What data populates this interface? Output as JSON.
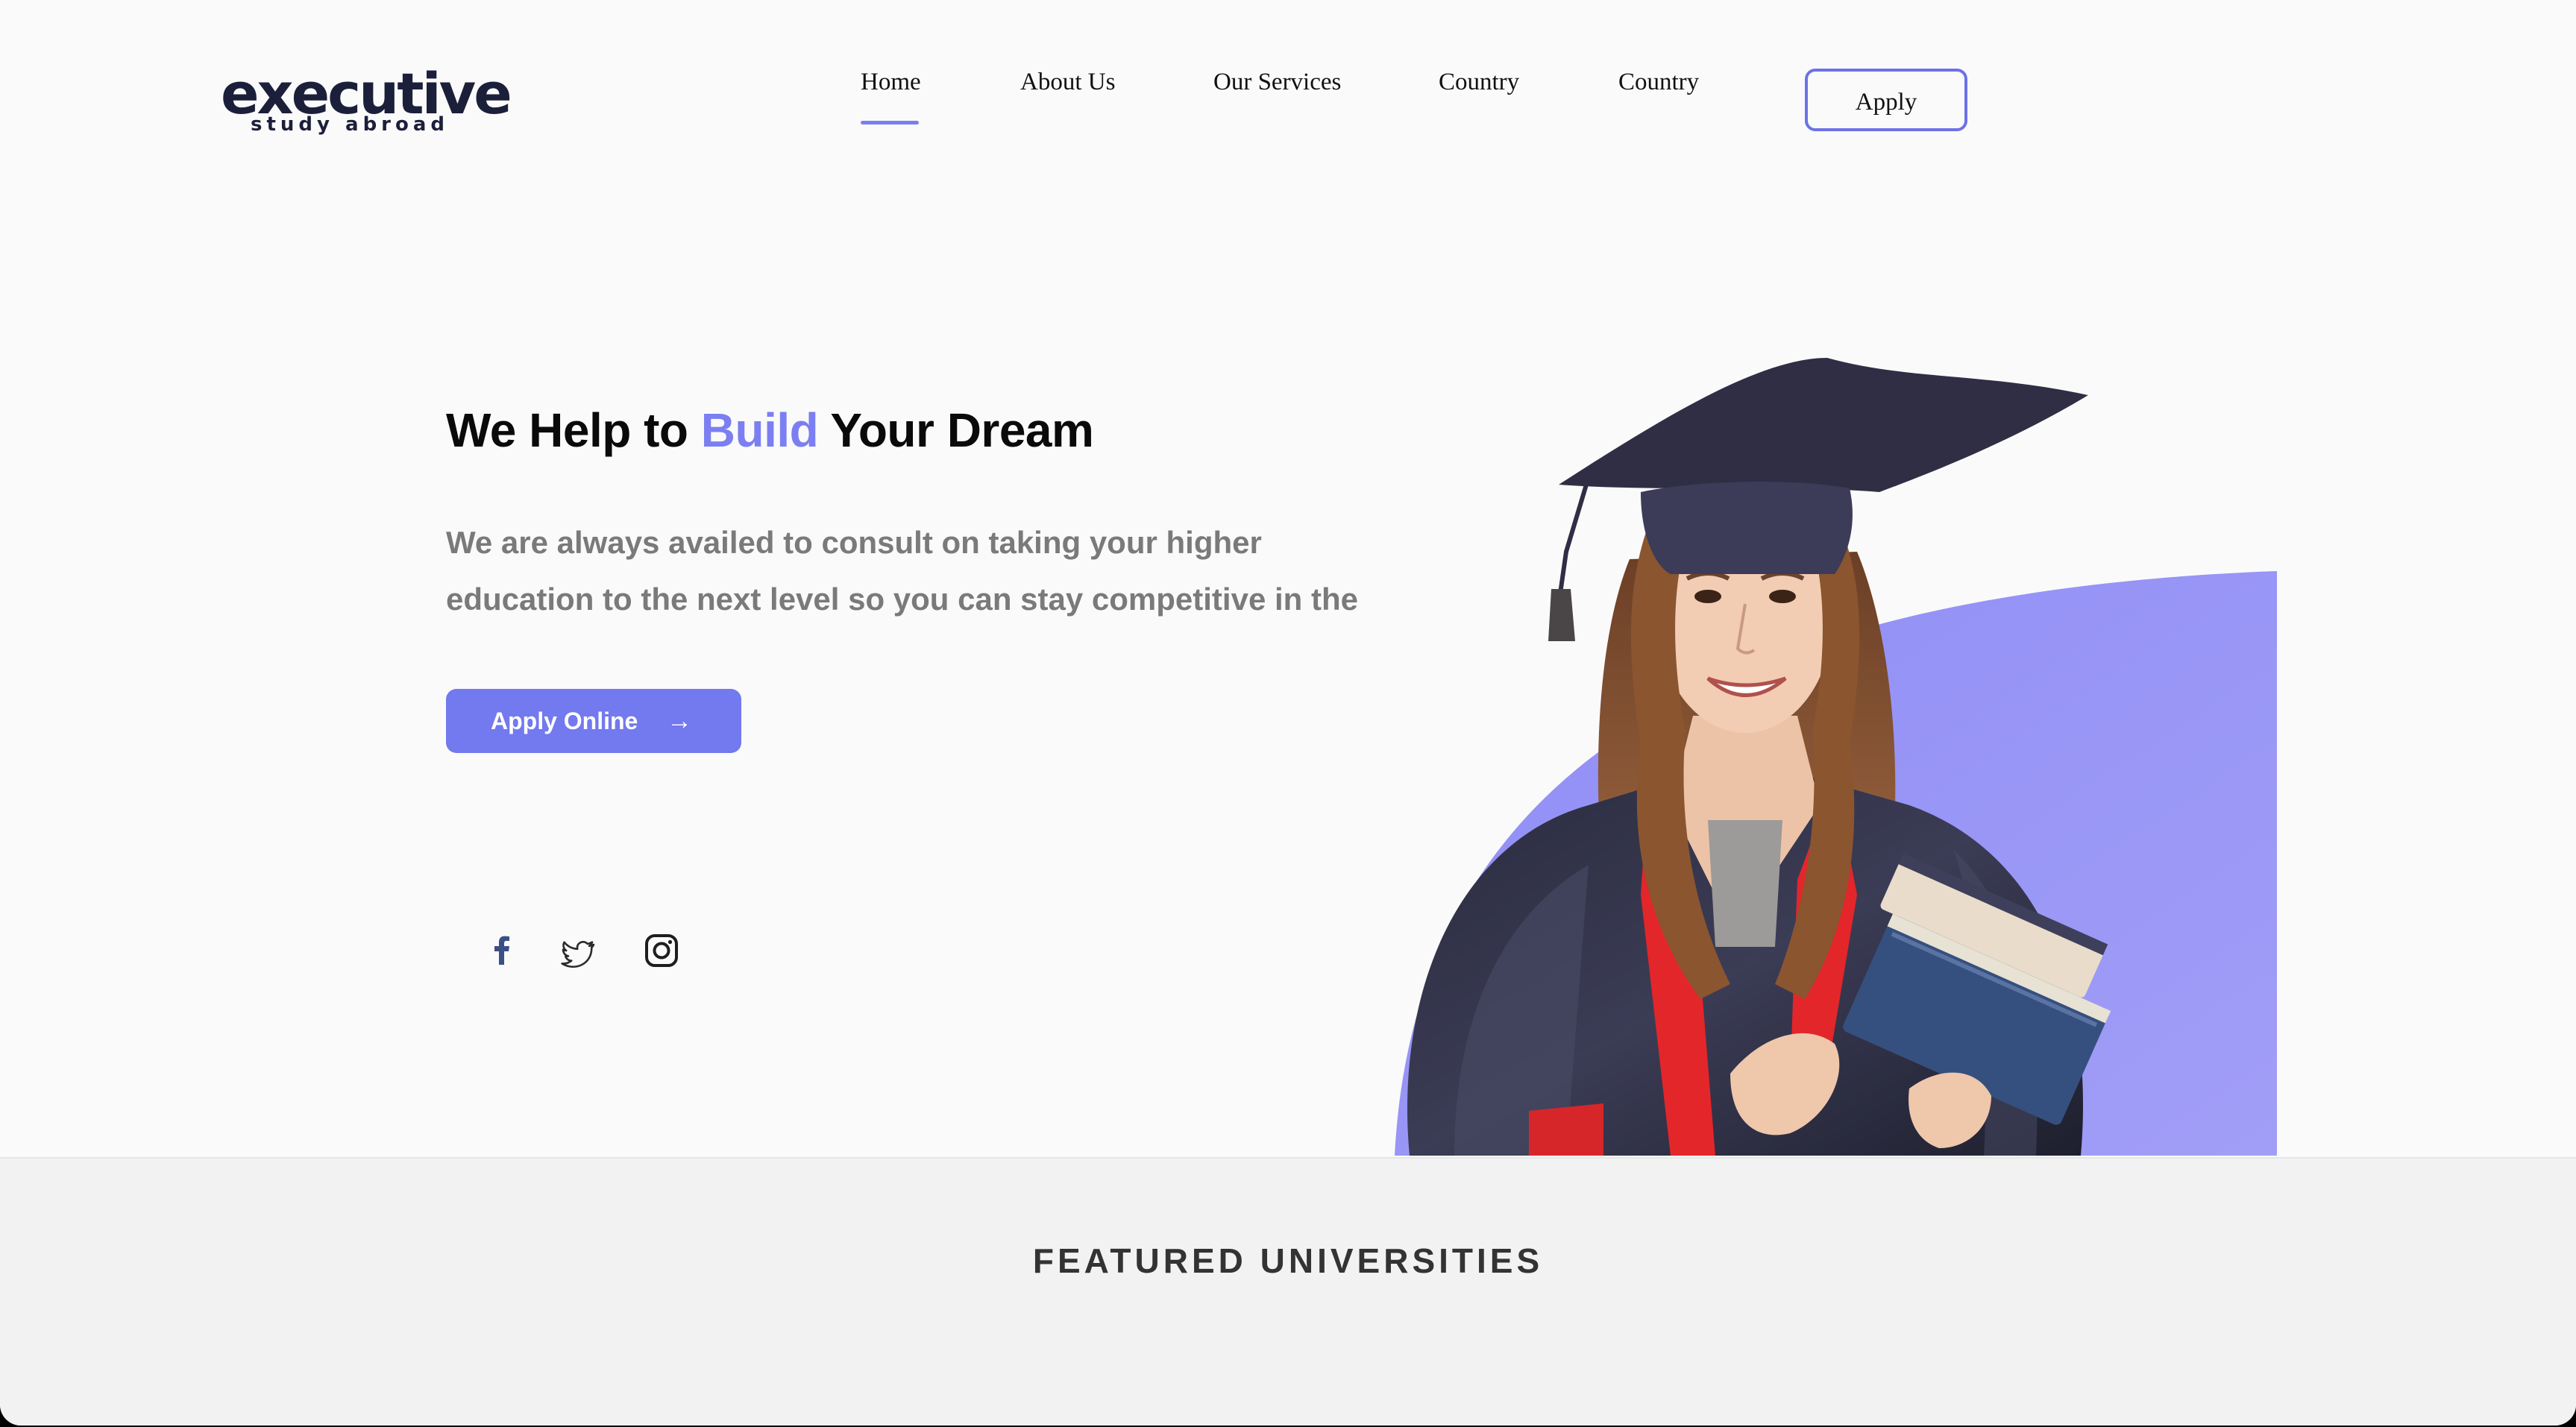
{
  "brand": {
    "name": "executive",
    "tagline": "study abroad"
  },
  "nav": {
    "items": [
      {
        "label": "Home",
        "active": true
      },
      {
        "label": "About Us"
      },
      {
        "label": "Our Services"
      },
      {
        "label": "Country"
      },
      {
        "label": "Country"
      }
    ],
    "apply_label": "Apply"
  },
  "hero": {
    "title_before": "We Help to ",
    "title_accent": "Build",
    "title_after": " Your Dream",
    "description_line1": "We are always availed to consult on taking your higher",
    "description_line2": "education to the next level so you can stay competitive in the",
    "cta_label": "Apply Online",
    "cta_arrow": "→"
  },
  "social": [
    {
      "icon": "facebook-icon"
    },
    {
      "icon": "twitter-icon"
    },
    {
      "icon": "instagram-icon"
    }
  ],
  "featured": {
    "title": "FEATURED UNIVERSITIES"
  },
  "colors": {
    "accent": "#7b7ff1",
    "button": "#7379ee",
    "blob": "#9b98f6",
    "logo": "#1c1f3a"
  }
}
